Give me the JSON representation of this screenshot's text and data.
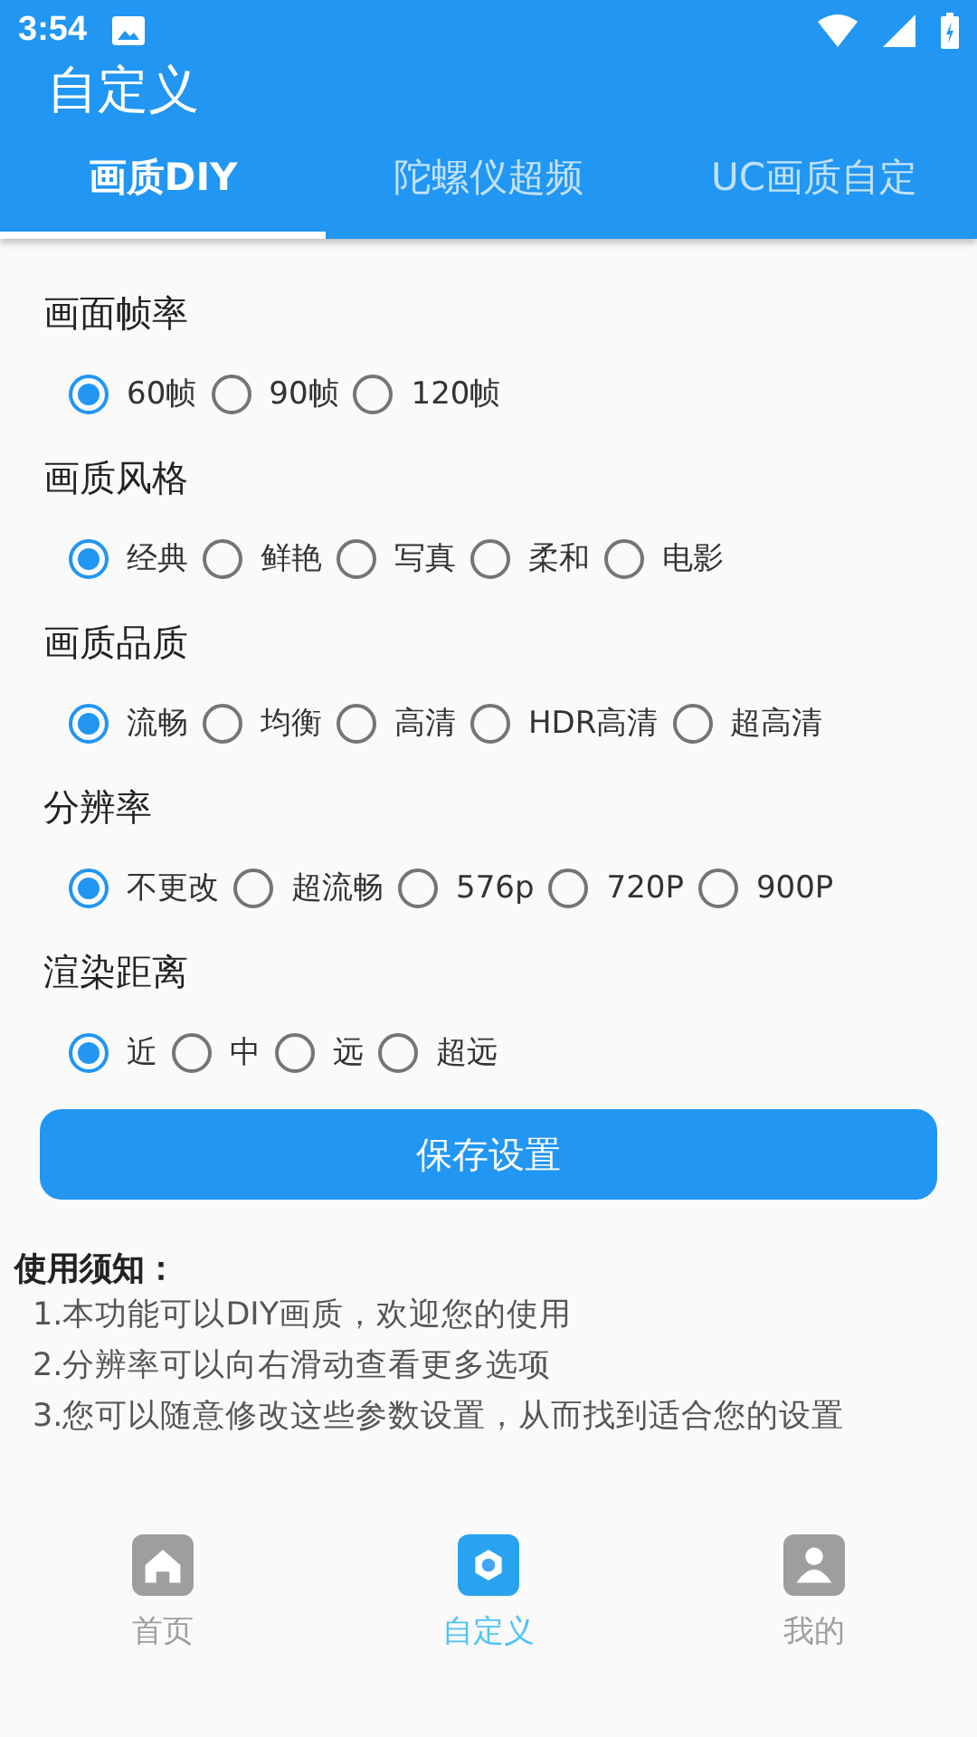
{
  "status_bar": {
    "time": "3:54"
  },
  "app_bar": {
    "title": "自定义"
  },
  "tabs": [
    {
      "label": "画质DIY",
      "selected": true
    },
    {
      "label": "陀螺仪超频",
      "selected": false
    },
    {
      "label": "UC画质自定",
      "selected": false
    }
  ],
  "groups": [
    {
      "title": "画面帧率",
      "options": [
        {
          "label": "60帧",
          "selected": true
        },
        {
          "label": "90帧",
          "selected": false
        },
        {
          "label": "120帧",
          "selected": false
        }
      ]
    },
    {
      "title": "画质风格",
      "options": [
        {
          "label": "经典",
          "selected": true
        },
        {
          "label": "鲜艳",
          "selected": false
        },
        {
          "label": "写真",
          "selected": false
        },
        {
          "label": "柔和",
          "selected": false
        },
        {
          "label": "电影",
          "selected": false
        }
      ]
    },
    {
      "title": "画质品质",
      "options": [
        {
          "label": "流畅",
          "selected": true
        },
        {
          "label": "均衡",
          "selected": false
        },
        {
          "label": "高清",
          "selected": false
        },
        {
          "label": "HDR高清",
          "selected": false
        },
        {
          "label": "超高清",
          "selected": false
        }
      ]
    },
    {
      "title": "分辨率",
      "options": [
        {
          "label": "不更改",
          "selected": true
        },
        {
          "label": "超流畅",
          "selected": false
        },
        {
          "label": "576p",
          "selected": false
        },
        {
          "label": "720P",
          "selected": false
        },
        {
          "label": "900P",
          "selected": false
        }
      ]
    },
    {
      "title": "渲染距离",
      "options": [
        {
          "label": "近",
          "selected": true
        },
        {
          "label": "中",
          "selected": false
        },
        {
          "label": "远",
          "selected": false
        },
        {
          "label": "超远",
          "selected": false
        }
      ]
    }
  ],
  "save_button": "保存设置",
  "notes": {
    "title": "使用须知：",
    "lines": [
      "1.本功能可以DIY画质，欢迎您的使用",
      "2.分辨率可以向右滑动查看更多选项",
      "3.您可以随意修改这些参数设置，从而找到适合您的设置"
    ]
  },
  "bottom_nav": [
    {
      "label": "首页",
      "kind": "home",
      "selected": false
    },
    {
      "label": "自定义",
      "kind": "custom",
      "selected": true
    },
    {
      "label": "我的",
      "kind": "profile",
      "selected": false
    }
  ]
}
